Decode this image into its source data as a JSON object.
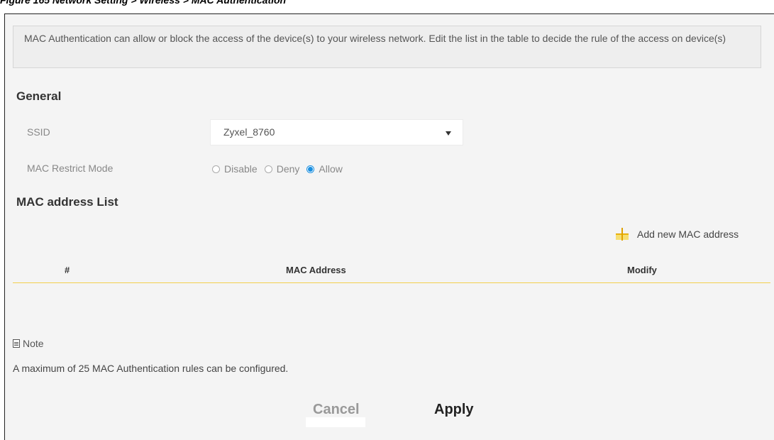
{
  "caption": "Figure 165   Network Setting > Wireless > MAC Authentication",
  "description": "MAC Authentication can allow or block the access of the device(s) to your wireless network. Edit the list in the table to decide the rule of the access on device(s)",
  "general": {
    "title": "General",
    "ssid_label": "SSID",
    "ssid_value": "Zyxel_8760",
    "mode_label": "MAC Restrict Mode",
    "mode_options": [
      "Disable",
      "Deny",
      "Allow"
    ],
    "mode_selected": "Allow"
  },
  "mac_list": {
    "title": "MAC address List",
    "add_label": "Add new MAC address",
    "columns": [
      "#",
      "MAC Address",
      "Modify"
    ],
    "rows": []
  },
  "note": {
    "title": "Note",
    "text": "A maximum of 25 MAC Authentication rules can be configured."
  },
  "buttons": {
    "cancel": "Cancel",
    "apply": "Apply"
  },
  "colors": {
    "accent": "#f6c800",
    "radio_selected": "#1a8fe0"
  }
}
